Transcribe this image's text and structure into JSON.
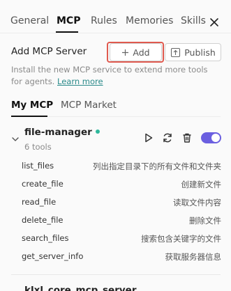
{
  "tabs": [
    {
      "label": "General"
    },
    {
      "label": "MCP"
    },
    {
      "label": "Rules"
    },
    {
      "label": "Memories"
    },
    {
      "label": "Skills"
    }
  ],
  "add_server": {
    "title": "Add MCP Server",
    "add_label": "Add",
    "publish_label": "Publish",
    "description": "Install the new MCP service to extend more tools for agents.",
    "learn_more": "Learn more"
  },
  "subtabs": [
    {
      "label": "My MCP"
    },
    {
      "label": "MCP Market"
    }
  ],
  "server": {
    "name": "file-manager",
    "tool_count": "6 tools",
    "enabled": true,
    "status_color": "#2eb89c",
    "toggle_color": "#6b5fe0",
    "tools": [
      {
        "name": "list_files",
        "desc": "列出指定目录下的所有文件和文件夹"
      },
      {
        "name": "create_file",
        "desc": "创建新文件"
      },
      {
        "name": "read_file",
        "desc": "读取文件内容"
      },
      {
        "name": "delete_file",
        "desc": "删除文件"
      },
      {
        "name": "search_files",
        "desc": "搜索包含关键字的文件"
      },
      {
        "name": "get_server_info",
        "desc": "获取服务器信息"
      }
    ]
  },
  "next_server": {
    "name": "klxl_core_mcp_server"
  },
  "icons": {
    "close": "close-icon",
    "add": "plus-icon",
    "publish": "upload-icon",
    "expand": "chevron-down-icon",
    "run": "play-icon",
    "refresh": "refresh-icon",
    "delete": "trash-icon"
  }
}
